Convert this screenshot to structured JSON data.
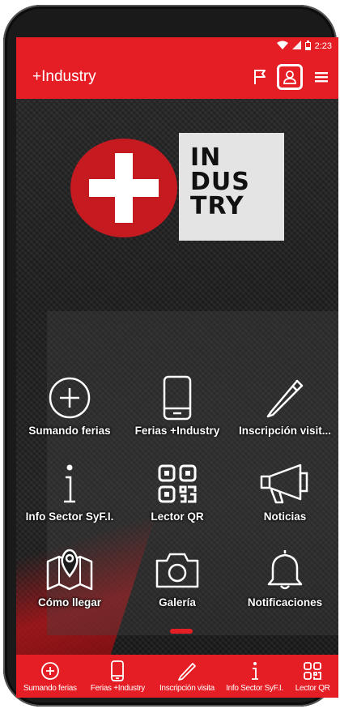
{
  "status_bar": {
    "time": "2:23",
    "icons": [
      "wifi-icon",
      "signal-icon",
      "battery-icon"
    ]
  },
  "app_bar": {
    "title": "+Industry",
    "actions": [
      "flag-icon",
      "profile-icon",
      "menu-icon"
    ]
  },
  "logo": {
    "text_lines": [
      "IN",
      "DUS",
      "TRY"
    ]
  },
  "tiles": [
    {
      "label": "Sumando ferias",
      "icon": "plus-circle-icon"
    },
    {
      "label": "Ferias +Industry",
      "icon": "mobile-icon"
    },
    {
      "label": "Inscripción visit...",
      "icon": "pencil-icon"
    },
    {
      "label": "Info Sector SyF.I.",
      "icon": "info-icon"
    },
    {
      "label": "Lector QR",
      "icon": "qr-code-icon"
    },
    {
      "label": "Noticias",
      "icon": "megaphone-icon"
    },
    {
      "label": "Cómo llegar",
      "icon": "map-icon"
    },
    {
      "label": "Galería",
      "icon": "camera-icon"
    },
    {
      "label": "Notificaciones",
      "icon": "bell-icon"
    }
  ],
  "bottom_nav": [
    {
      "label": "Sumando ferias",
      "icon": "plus-circle-icon"
    },
    {
      "label": "Ferias +Industry",
      "icon": "mobile-icon"
    },
    {
      "label": "Inscripción visita",
      "icon": "pencil-icon"
    },
    {
      "label": "Info Sector SyF.I.",
      "icon": "info-icon"
    },
    {
      "label": "Lector QR",
      "icon": "qr-code-icon"
    }
  ],
  "colors": {
    "brand_red": "#e51e25",
    "background": "#1b1b1b",
    "logo_box": "#e4e4e4"
  }
}
